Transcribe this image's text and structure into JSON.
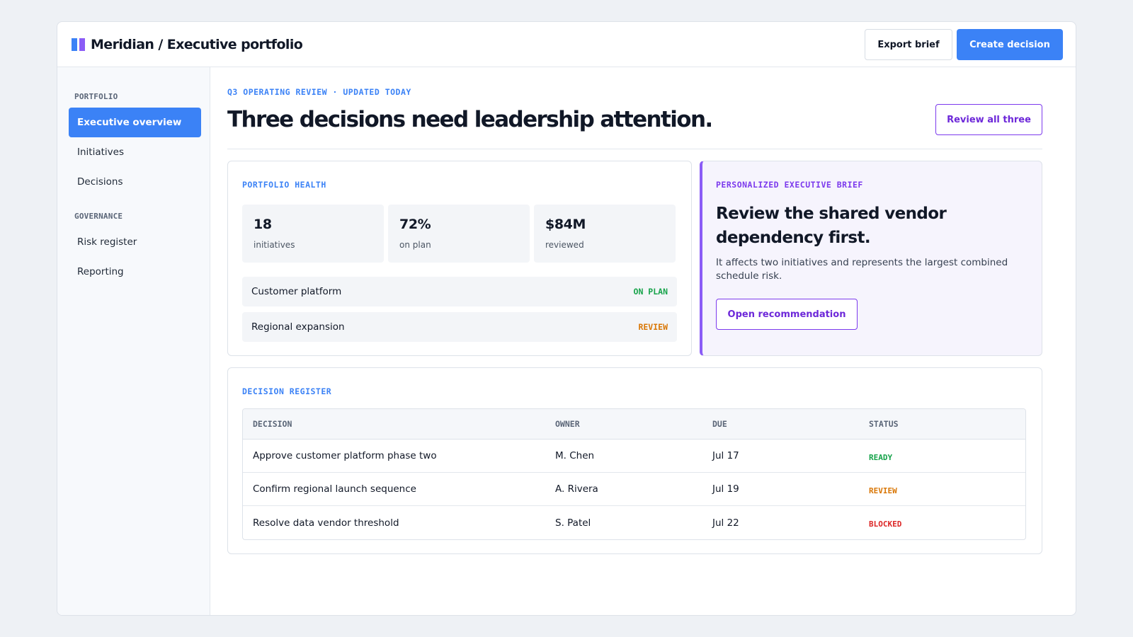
{
  "header": {
    "title": "Meridian / Executive portfolio",
    "export_label": "Export brief",
    "create_label": "Create decision"
  },
  "colors": {
    "accent_blue": "#3b82f6",
    "accent_purple": "#7c3aed",
    "status_green": "#16a34a",
    "status_orange": "#d97706",
    "status_red": "#dc2626"
  },
  "sidebar": {
    "groups": [
      {
        "heading": "PORTFOLIO",
        "items": [
          {
            "label": "Executive overview",
            "active": true
          },
          {
            "label": "Initiatives",
            "active": false
          },
          {
            "label": "Decisions",
            "active": false
          }
        ]
      },
      {
        "heading": "GOVERNANCE",
        "items": [
          {
            "label": "Risk register",
            "active": false
          },
          {
            "label": "Reporting",
            "active": false
          }
        ]
      }
    ]
  },
  "main": {
    "eyebrow": "Q3 OPERATING REVIEW · UPDATED TODAY",
    "headline": "Three decisions need leadership attention.",
    "review_label": "Review all three"
  },
  "health": {
    "label": "PORTFOLIO HEALTH",
    "stats": [
      {
        "value": "18",
        "label": "initiatives"
      },
      {
        "value": "72%",
        "label": "on plan"
      },
      {
        "value": "$84M",
        "label": "reviewed"
      }
    ],
    "rows": [
      {
        "name": "Customer platform",
        "status": "ON PLAN",
        "tone": "green"
      },
      {
        "name": "Regional expansion",
        "status": "REVIEW",
        "tone": "orange"
      }
    ]
  },
  "brief": {
    "label": "PERSONALIZED EXECUTIVE BRIEF",
    "title": "Review the shared vendor dependency first.",
    "body": "It affects two initiatives and represents the largest combined schedule risk.",
    "button_label": "Open recommendation"
  },
  "register": {
    "label": "DECISION REGISTER",
    "columns": [
      "DECISION",
      "OWNER",
      "DUE",
      "STATUS"
    ],
    "rows": [
      {
        "decision": "Approve customer platform phase two",
        "owner": "M. Chen",
        "due": "Jul 17",
        "status": "READY",
        "tone": "green"
      },
      {
        "decision": "Confirm regional launch sequence",
        "owner": "A. Rivera",
        "due": "Jul 19",
        "status": "REVIEW",
        "tone": "orange"
      },
      {
        "decision": "Resolve data vendor threshold",
        "owner": "S. Patel",
        "due": "Jul 22",
        "status": "BLOCKED",
        "tone": "red"
      }
    ]
  }
}
